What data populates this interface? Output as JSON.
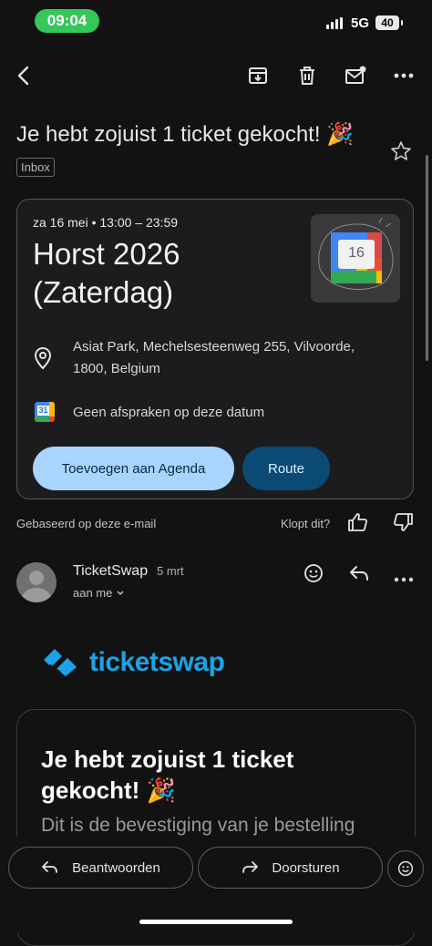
{
  "status_bar": {
    "time": "09:04",
    "network": "5G",
    "battery": "40"
  },
  "email": {
    "subject": "Je hebt zojuist 1 ticket gekocht! 🎉",
    "label": "Inbox"
  },
  "event_card": {
    "date_time": "za 16 mei • 13:00 – 23:59",
    "title_line1": "Horst 2026",
    "title_line2": "(Zaterdag)",
    "calendar_day": "16",
    "location_line1": "Asiat Park, Mechelsesteenweg 255, Vilvoorde,",
    "location_line2": "1800, Belgium",
    "calendar_icon_day": "31",
    "no_events": "Geen afspraken op deze datum",
    "add_button": "Toevoegen aan Agenda",
    "route_button": "Route"
  },
  "feedback": {
    "based_on": "Gebaseerd op deze e-mail",
    "question": "Klopt dit?"
  },
  "message": {
    "sender": "TicketSwap",
    "date": "5 mrt",
    "recipient": "aan me"
  },
  "body": {
    "brand": "ticketswap",
    "heading_line1": "Je hebt zojuist 1 ticket",
    "heading_line2": "gekocht! 🎉",
    "subtext": "Dit is de bevestiging van je bestelling"
  },
  "actions": {
    "reply": "Beantwoorden",
    "forward": "Doorsturen"
  },
  "colors": {
    "accent_blue": "#a8d5ff",
    "route_blue": "#0b4a74",
    "brand_blue": "#1aa3e8",
    "status_green": "#35c759"
  }
}
